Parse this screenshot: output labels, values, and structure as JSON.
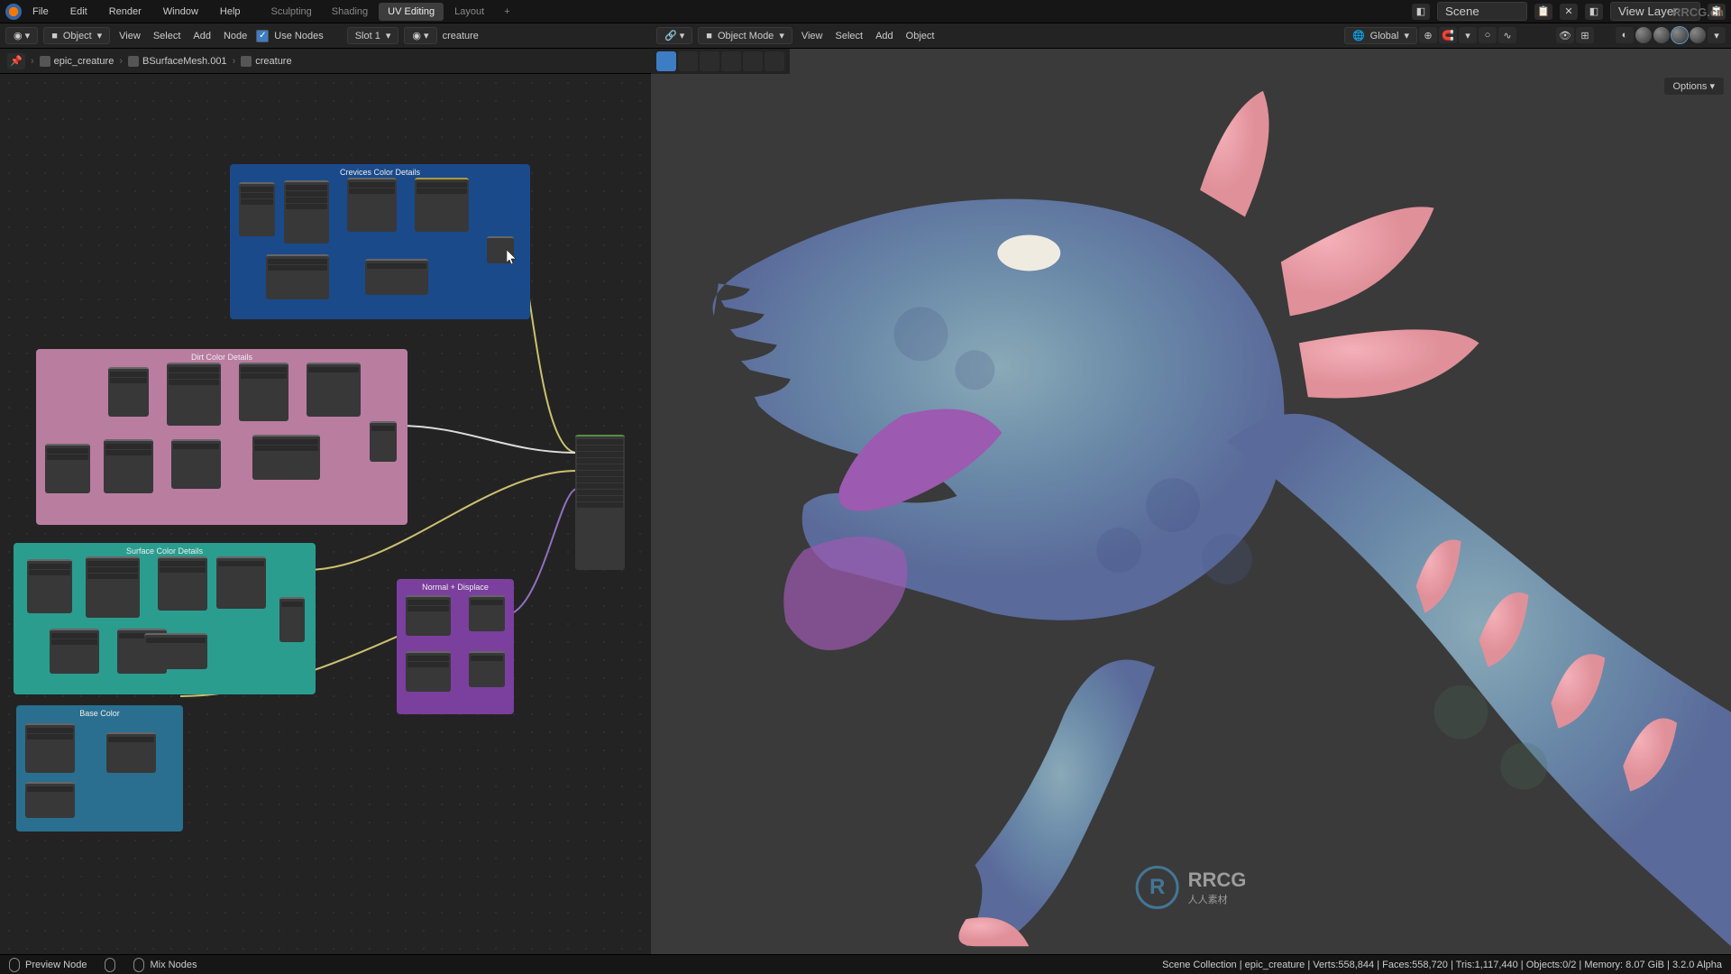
{
  "topmenu": {
    "file": "File",
    "edit": "Edit",
    "render": "Render",
    "window": "Window",
    "help": "Help"
  },
  "workspaces": {
    "sculpting": "Sculpting",
    "shading": "Shading",
    "uv": "UV Editing",
    "layout": "Layout",
    "add": "+"
  },
  "scene": {
    "label": "Scene",
    "layer": "View Layer"
  },
  "node_header": {
    "object": "Object",
    "view": "View",
    "select": "Select",
    "add": "Add",
    "node": "Node",
    "use_nodes": "Use Nodes",
    "slot": "Slot 1",
    "material": "creature"
  },
  "breadcrumb": {
    "file": "epic_creature",
    "obj": "BSurfaceMesh.001",
    "mat": "creature"
  },
  "frames": {
    "crevices": "Crevices Color Details",
    "dirt": "Dirt Color Details",
    "surface": "Surface Color Details",
    "normal": "Normal + Displace",
    "base": "Base Color"
  },
  "vp_header": {
    "mode": "Object Mode",
    "view": "View",
    "select": "Select",
    "add": "Add",
    "object": "Object",
    "global": "Global",
    "options": "Options"
  },
  "watermark": {
    "logo": "R",
    "big": "RRCG",
    "small": "人人素材"
  },
  "topright_wm": "RRCG.cn",
  "status": {
    "preview": "Preview Node",
    "mix": "Mix Nodes",
    "stats": "Scene Collection | epic_creature | Verts:558,844 | Faces:558,720 | Tris:1,117,440 | Objects:0/2 | Memory: 8.07 GiB | 3.2.0 Alpha"
  }
}
